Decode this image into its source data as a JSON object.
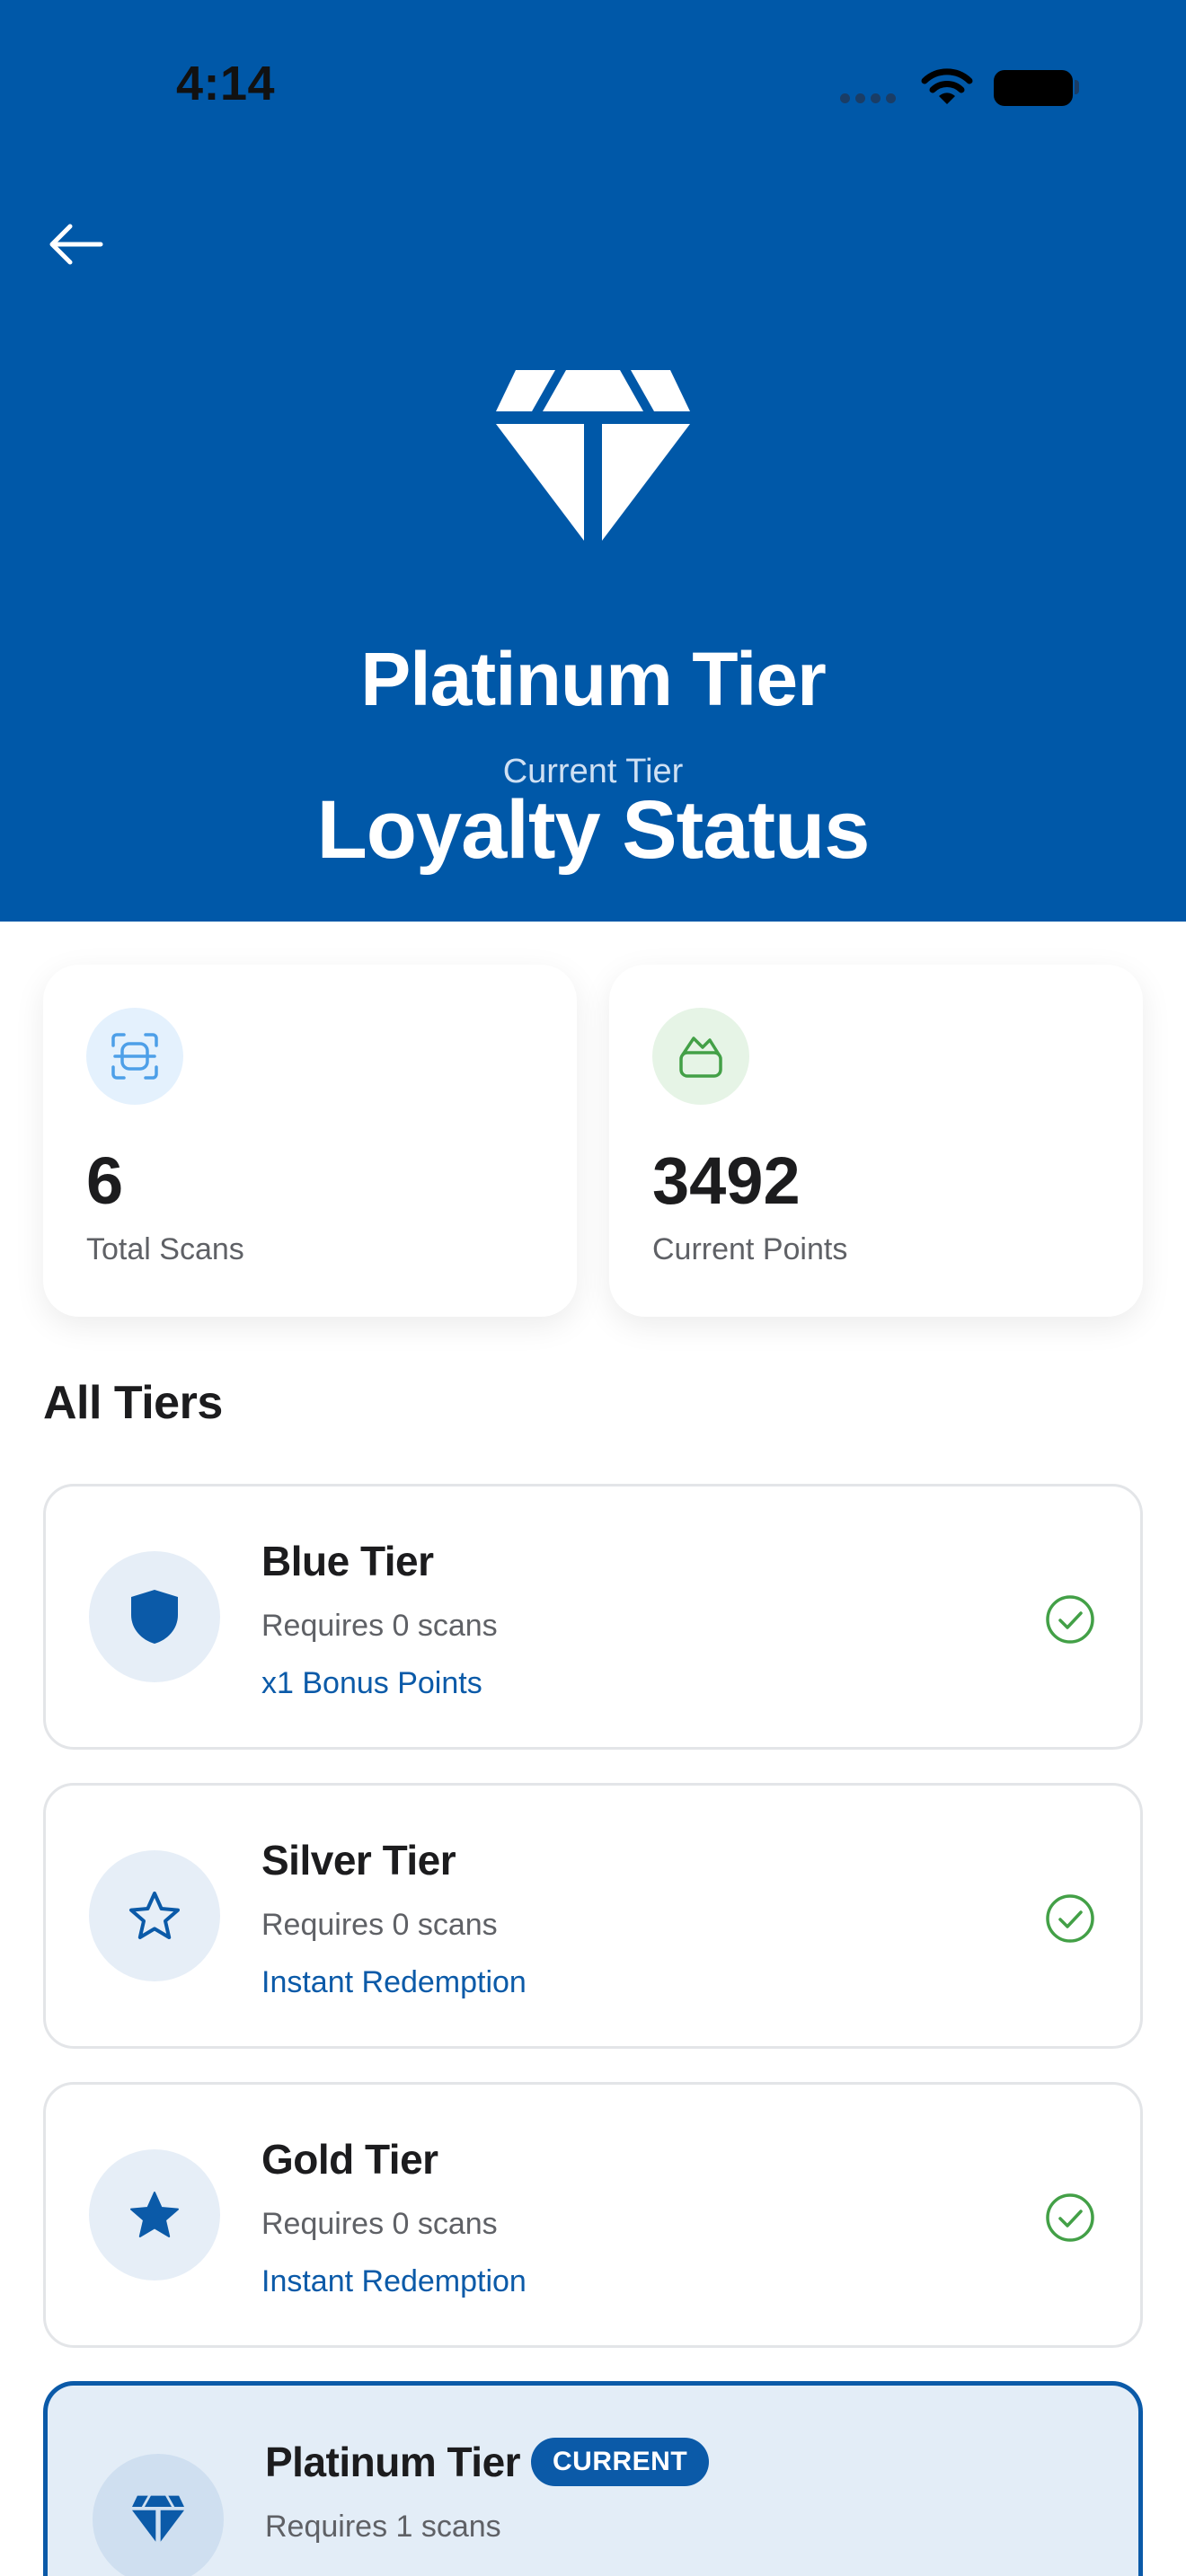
{
  "status_bar": {
    "time": "4:14"
  },
  "header": {
    "tier_title": "Platinum Tier",
    "caption": "Current Tier",
    "heading": "Loyalty Status",
    "background_color": "#0058a8",
    "icon": "diamond-icon"
  },
  "stats": [
    {
      "value": "6",
      "label": "Total Scans",
      "icon": "scan-icon",
      "accent": "#4d9fe8"
    },
    {
      "value": "3492",
      "label": "Current Points",
      "icon": "wallet-icon",
      "accent": "#43a047"
    }
  ],
  "section_title": "All Tiers",
  "tiers": [
    {
      "name": "Blue Tier",
      "requirement": "Requires 0 scans",
      "perk": "x1 Bonus Points",
      "icon": "shield-icon",
      "achieved": true
    },
    {
      "name": "Silver Tier",
      "requirement": "Requires 0 scans",
      "perk": "Instant Redemption",
      "icon": "star-outline-icon",
      "achieved": true
    },
    {
      "name": "Gold Tier",
      "requirement": "Requires 0 scans",
      "perk": "Instant Redemption",
      "icon": "star-filled-icon",
      "achieved": true
    },
    {
      "name": "Platinum Tier",
      "requirement": "Requires 1 scans",
      "badge": "CURRENT",
      "icon": "diamond-icon",
      "current": true
    }
  ],
  "colors": {
    "accent": "#0b5aa8",
    "success": "#43a047",
    "card_border": "#e3e5e8"
  }
}
